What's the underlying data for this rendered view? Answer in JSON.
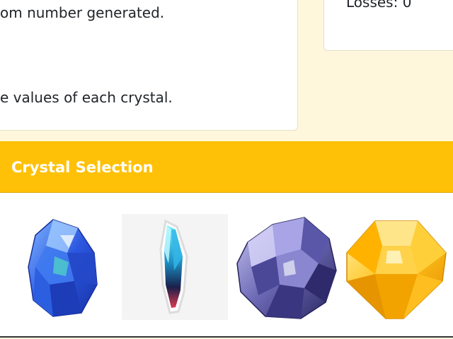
{
  "instructions": {
    "line1": "om number generated.",
    "line2": "e values of each crystal."
  },
  "score": {
    "losses_text": "Losses: 0"
  },
  "crystal_selection": {
    "title": "Crystal Selection",
    "crystals": [
      {
        "icon": "blue-sapphire-crystal-icon",
        "color": "#2f5bd8"
      },
      {
        "icon": "cyan-red-shard-crystal-icon",
        "color": "#27c7e6"
      },
      {
        "icon": "purple-geode-crystal-icon",
        "color": "#6d6bb0"
      },
      {
        "icon": "yellow-topaz-crystal-icon",
        "color": "#ffc21a"
      }
    ]
  },
  "colors": {
    "page_bg": "#fff7dc",
    "header_bg": "#ffc107",
    "header_text": "#ffffff"
  }
}
